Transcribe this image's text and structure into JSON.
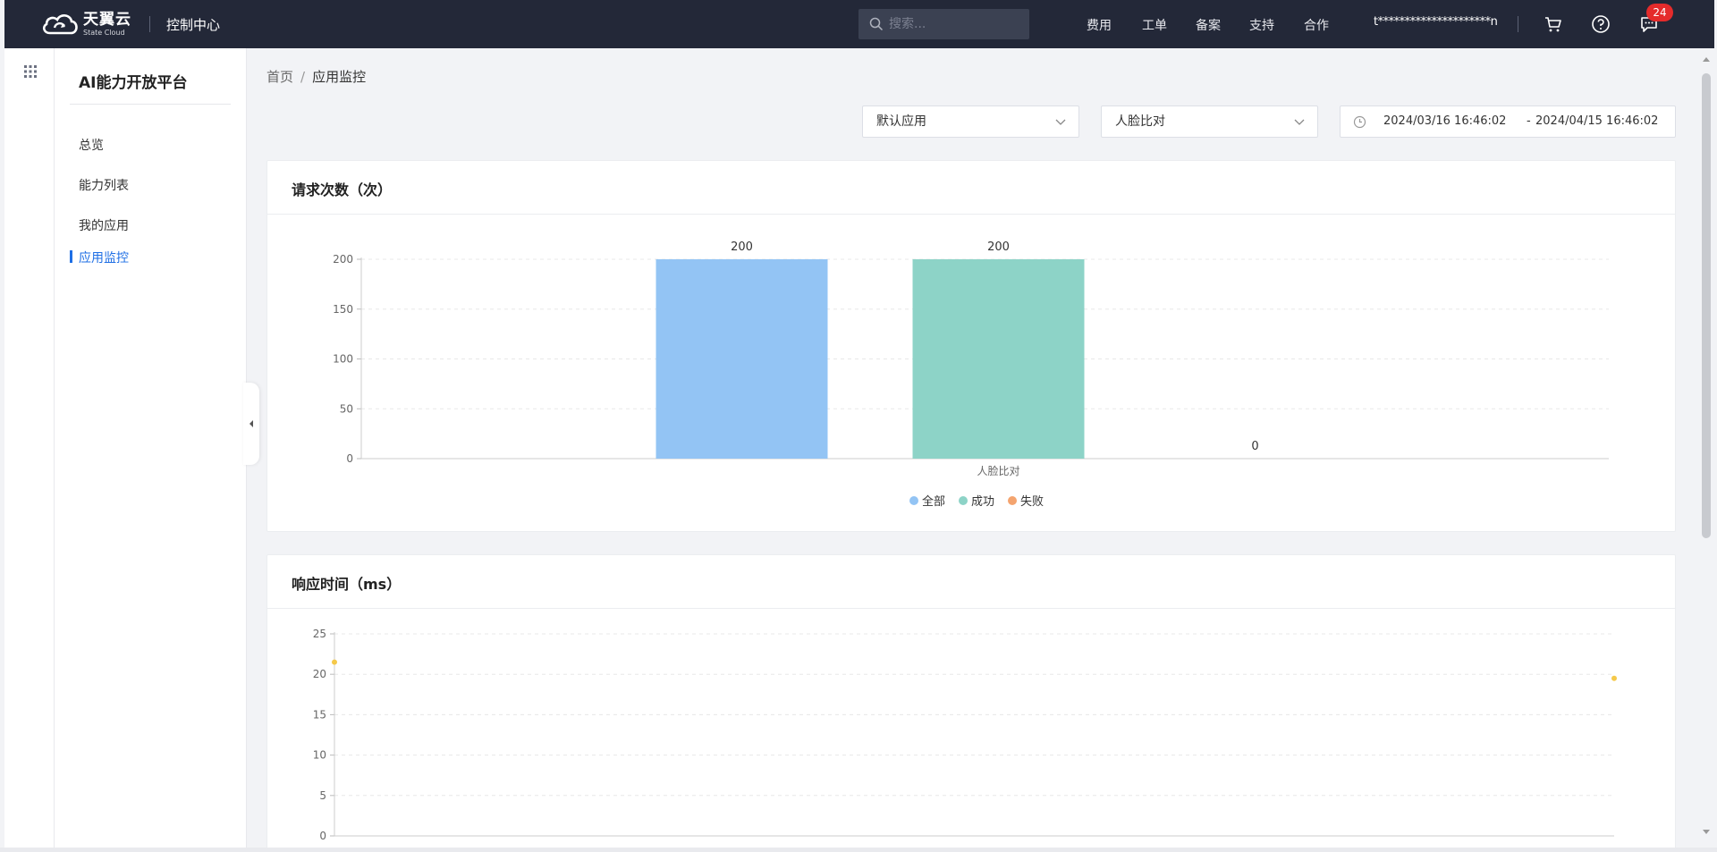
{
  "brand": {
    "name": "天翼云",
    "sub": "State Cloud",
    "console": "控制中心"
  },
  "search": {
    "placeholder": "搜索..."
  },
  "nav": [
    "费用",
    "工单",
    "备案",
    "支持",
    "合作"
  ],
  "user": "t*********************n",
  "notifications": {
    "count": "24"
  },
  "sidebar": {
    "title": "AI能力开放平台",
    "items": [
      "总览",
      "能力列表",
      "我的应用",
      "应用监控"
    ],
    "active_index": 3
  },
  "breadcrumb": {
    "home": "首页",
    "separator": "/",
    "current": "应用监控"
  },
  "filters": {
    "app": "默认应用",
    "ability": "人脸比对",
    "date_start": "2024/03/16 16:46:02",
    "date_separator": "-",
    "date_end": "2024/04/15 16:46:02"
  },
  "icons": {
    "search": "search-icon",
    "cart": "cart-icon",
    "help": "help-icon",
    "message": "message-icon",
    "grid": "grid-icon",
    "collapse": "caret-left-icon",
    "chevron": "chevron-down-icon",
    "clock": "clock-icon"
  },
  "colors": {
    "all": "#93c4f4",
    "success": "#8dd3c7",
    "fail": "#f4a46f",
    "response": "#f5c94a",
    "active": "#1f6fe5"
  },
  "charts": {
    "requests_title": "请求次数（次）",
    "response_title": "响应时间（ms）"
  },
  "chart_data": [
    {
      "type": "bar",
      "title": "请求次数（次）",
      "categories": [
        "人脸比对"
      ],
      "series": [
        {
          "name": "全部",
          "values": [
            200
          ]
        },
        {
          "name": "成功",
          "values": [
            200
          ]
        },
        {
          "name": "失败",
          "values": [
            0
          ]
        }
      ],
      "ylim": [
        0,
        200
      ],
      "yticks": [
        0,
        50,
        100,
        150,
        200
      ],
      "grid": true,
      "legend": "bottom-center"
    },
    {
      "type": "scatter",
      "title": "响应时间（ms）",
      "x": [
        0,
        1
      ],
      "y": [
        21.5,
        19.5
      ],
      "ylim": [
        0,
        25
      ],
      "yticks": [
        0,
        5,
        10,
        15,
        20,
        25
      ],
      "grid": true
    }
  ]
}
